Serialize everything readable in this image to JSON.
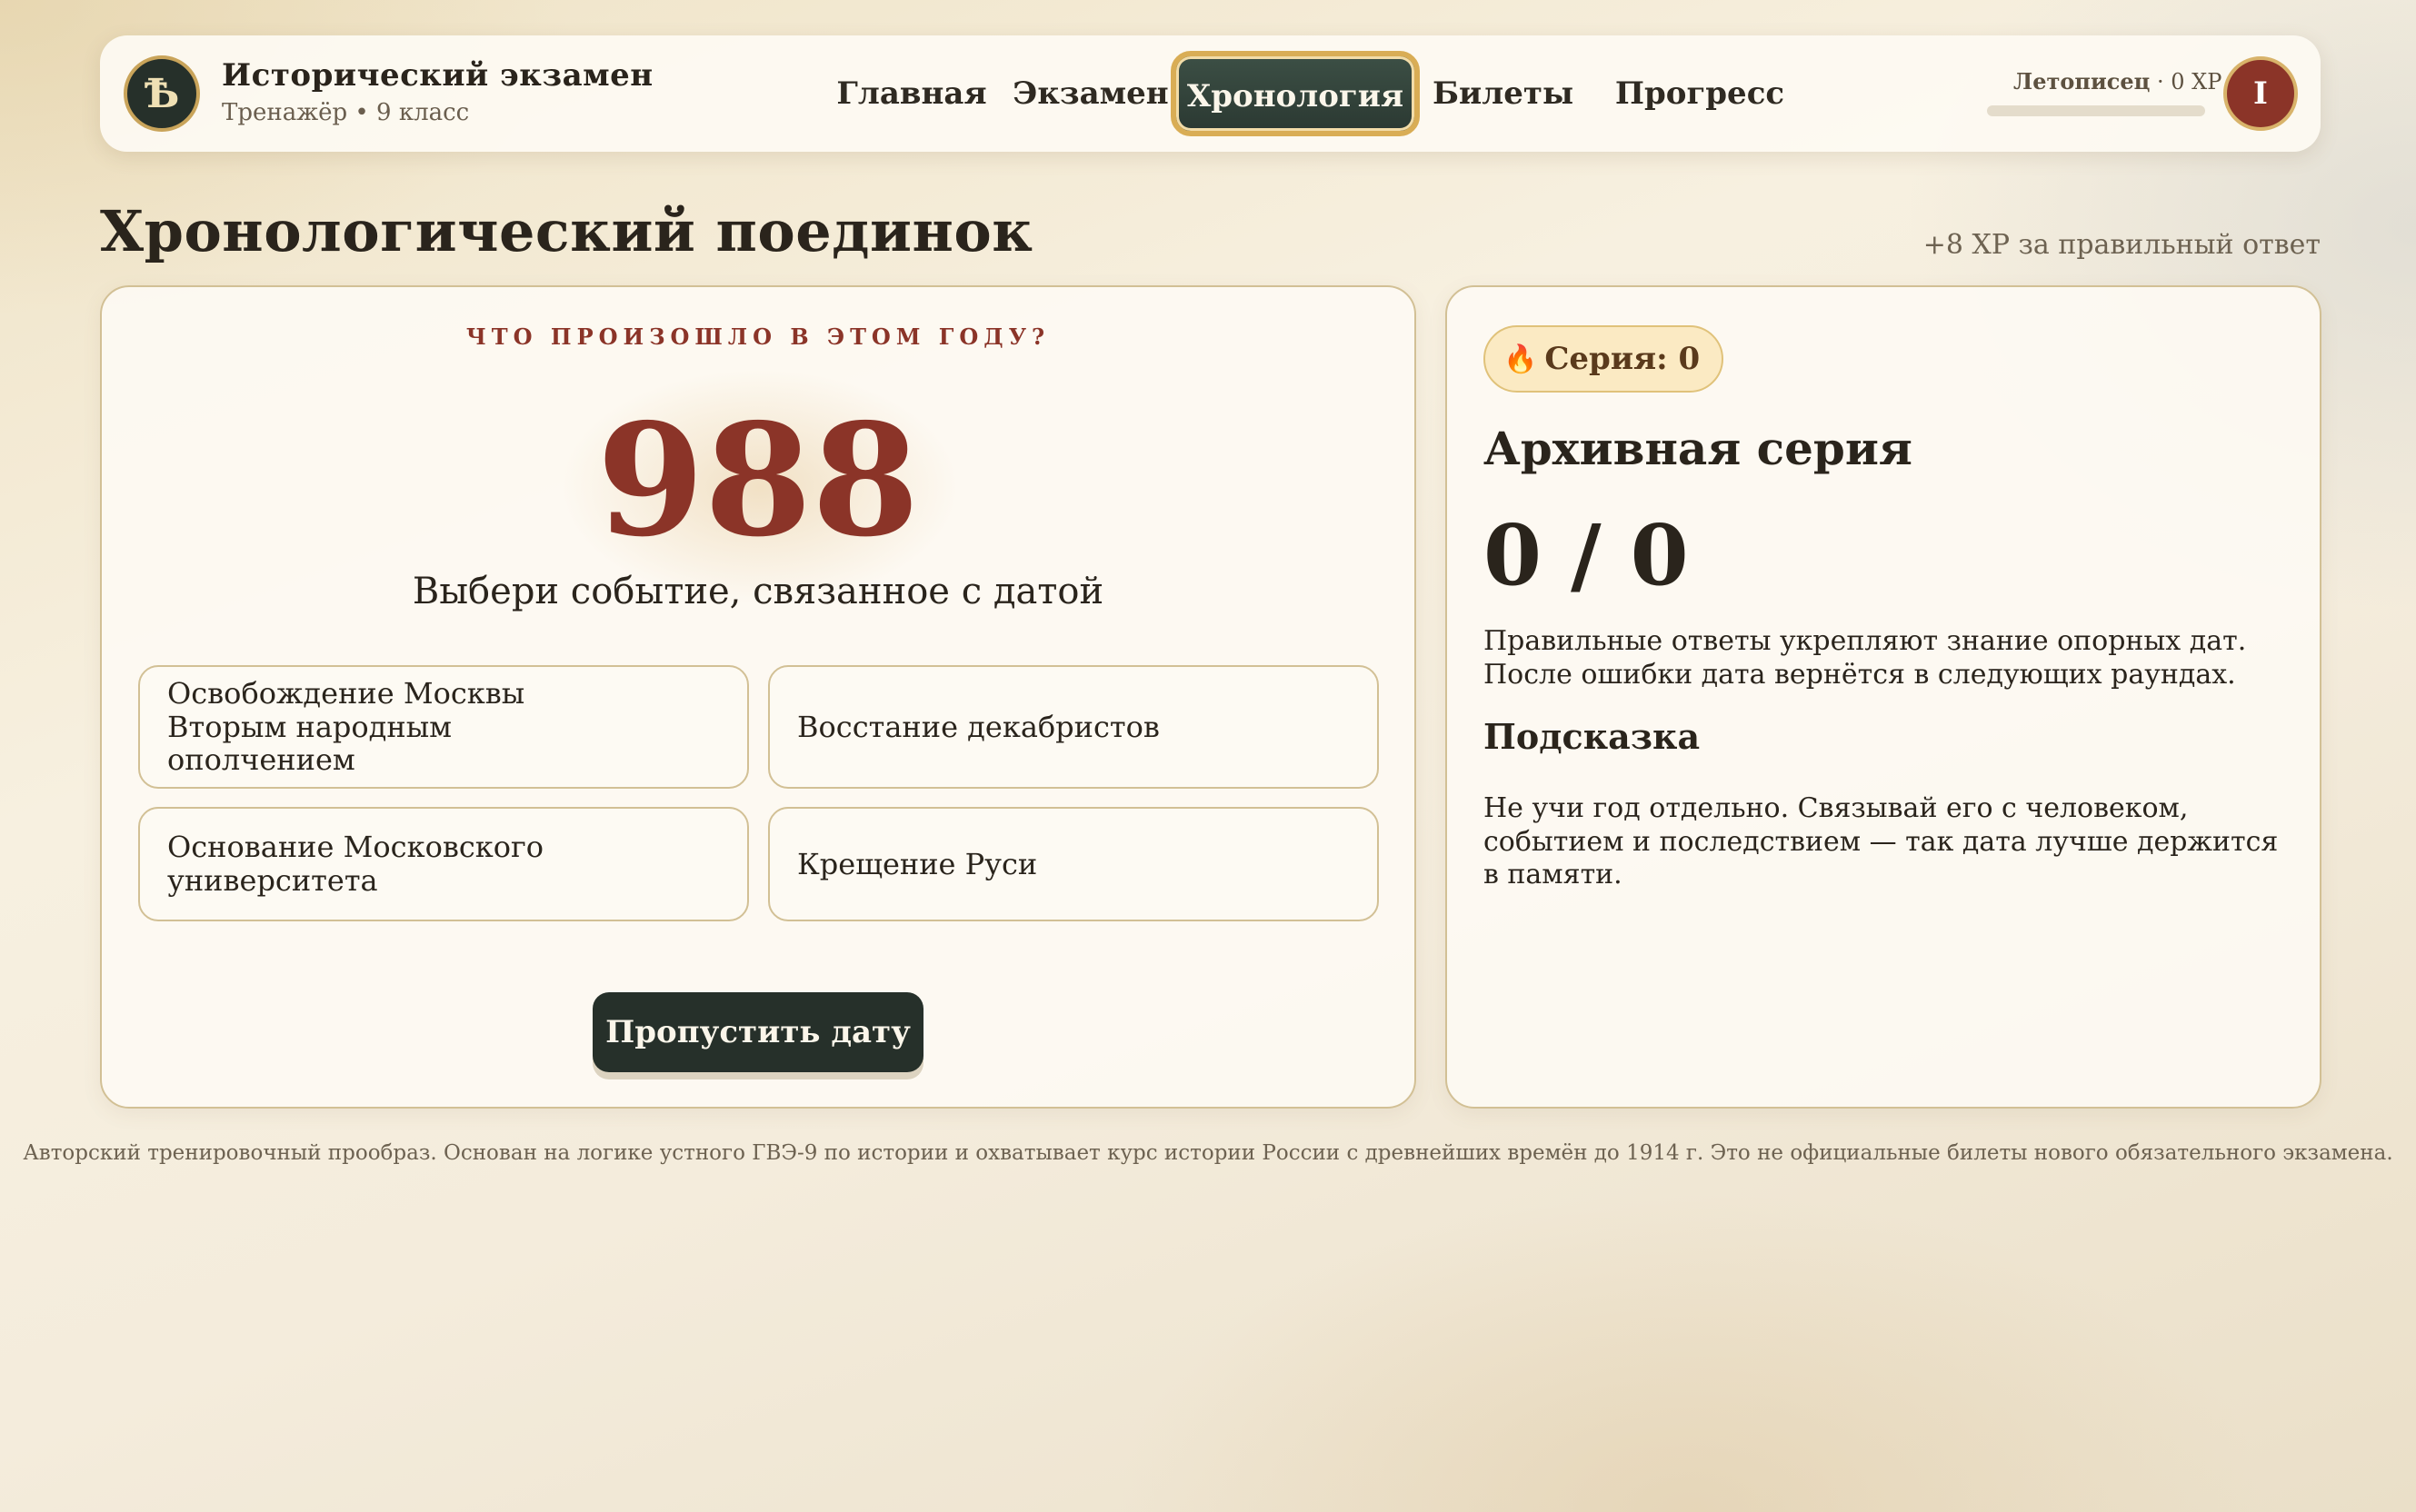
{
  "brand": {
    "logo_letter": "Ѣ",
    "title": "Исторический экзамен",
    "subtitle": "Тренажёр • 9 класс"
  },
  "nav": {
    "items": [
      {
        "label": "Главная"
      },
      {
        "label": "Экзамен"
      },
      {
        "label": "Хронология",
        "active": true
      },
      {
        "label": "Билеты"
      },
      {
        "label": "Прогресс"
      }
    ]
  },
  "user": {
    "rank": "Летописец",
    "xp_text": " · 0 XP",
    "xp_progress": 0,
    "avatar_letter": "I"
  },
  "page": {
    "title": "Хронологический поединок",
    "xp_hint": "+8 XP за правильный ответ"
  },
  "quiz": {
    "question": "ЧТО ПРОИЗОШЛО В ЭТОМ ГОДУ?",
    "year": "988",
    "instruction": "Выбери событие, связанное с датой",
    "options": [
      {
        "label": "Освобождение Москвы Вторым народным ополчением"
      },
      {
        "label": "Восстание декабристов"
      },
      {
        "label": "Основание Московского университета"
      },
      {
        "label": "Крещение Руси"
      }
    ],
    "skip_label": "Пропустить дату"
  },
  "side": {
    "streak_icon": "fire-icon",
    "streak_label": "Серия: 0",
    "title": "Архивная серия",
    "score": "0 / 0",
    "description": "Правильные ответы укрепляют знание опорных дат. После ошибки дата вернётся в следующих раундах.",
    "hint_title": "Подсказка",
    "hint_text": "Не учи год отдельно. Связывай его с человеком, событием и последствием — так дата лучше держится в памяти."
  },
  "footer": {
    "text": "Авторский тренировочный прообраз. Основан на логике устного ГВЭ-9 по истории и охватывает курс истории России с древнейших времён до 1914 г. Это не официальные билеты нового обязательного экзамена."
  },
  "colors": {
    "accent_red": "#8b3428",
    "dark_green": "#26302a",
    "gold": "#d9ad55"
  }
}
